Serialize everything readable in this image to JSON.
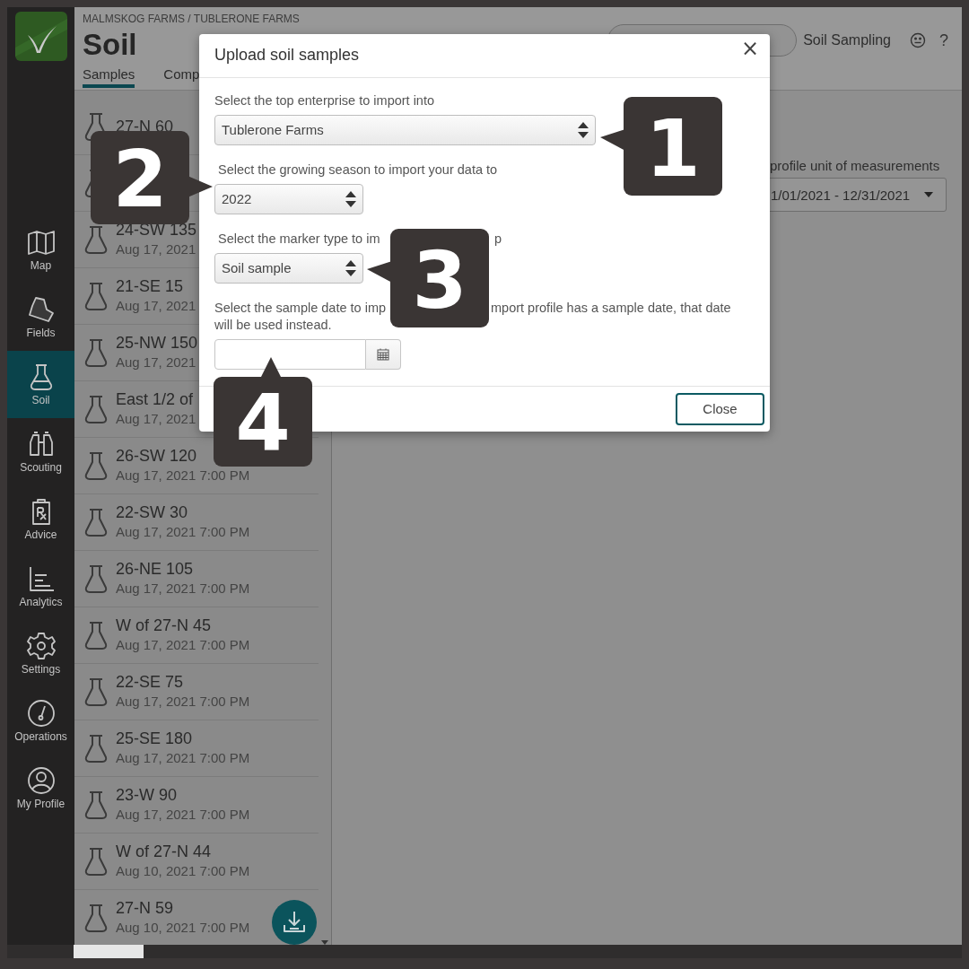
{
  "breadcrumb": "MALMSKOG FARMS / TUBLERONE FARMS",
  "page_title": "Soil",
  "tabs": [
    {
      "label": "Samples",
      "selected": true
    },
    {
      "label": "Comp",
      "selected": false
    }
  ],
  "header_link": "Soil Sampling",
  "help": "?",
  "nav": [
    {
      "kind": "map",
      "label": "Map",
      "selected": false
    },
    {
      "kind": "fields",
      "label": "Fields",
      "selected": false
    },
    {
      "kind": "soil",
      "label": "Soil",
      "selected": true
    },
    {
      "kind": "scouting",
      "label": "Scouting",
      "selected": false
    },
    {
      "kind": "advice",
      "label": "Advice",
      "selected": false
    },
    {
      "kind": "analytics",
      "label": "Analytics",
      "selected": false
    },
    {
      "kind": "settings",
      "label": "Settings",
      "selected": false
    },
    {
      "kind": "operations",
      "label": "Operations",
      "selected": false
    },
    {
      "kind": "profile",
      "label": "My Profile",
      "selected": false
    }
  ],
  "samples": [
    {
      "kind": "sample",
      "title": "27-N 60"
    },
    {
      "kind": "covered"
    },
    {
      "kind": "sample",
      "title": "24-SW 135",
      "date": "Aug 17, 2021"
    },
    {
      "kind": "sample",
      "title": "21-SE 15",
      "date": "Aug 17, 2021"
    },
    {
      "kind": "sample",
      "title": "25-NW 150",
      "date": "Aug 17, 2021"
    },
    {
      "kind": "sample",
      "title": "East 1/2 of",
      "date": "Aug 17, 2021"
    },
    {
      "kind": "sample",
      "title": "26-SW 120",
      "date": "Aug 17, 2021 7:00 PM"
    },
    {
      "kind": "sample",
      "title": "22-SW 30",
      "date": "Aug 17, 2021 7:00 PM"
    },
    {
      "kind": "sample",
      "title": "26-NE 105",
      "date": "Aug 17, 2021 7:00 PM"
    },
    {
      "kind": "sample",
      "title": "W of 27-N 45",
      "date": "Aug 17, 2021 7:00 PM"
    },
    {
      "kind": "sample",
      "title": "22-SE 75",
      "date": "Aug 17, 2021 7:00 PM"
    },
    {
      "kind": "sample",
      "title": "25-SE 180",
      "date": "Aug 17, 2021 7:00 PM"
    },
    {
      "kind": "sample",
      "title": "23-W 90",
      "date": "Aug 17, 2021 7:00 PM"
    },
    {
      "kind": "sample",
      "title": "W of 27-N 44",
      "date": "Aug 10, 2021 7:00 PM"
    },
    {
      "kind": "sample",
      "title": "27-N 59",
      "date": "Aug 10, 2021 7:00 PM"
    }
  ],
  "main": {
    "label": "profile unit of measurements",
    "date_range": "1/01/2021 - 12/31/2021"
  },
  "dialog": {
    "title": "Upload soil samples",
    "close": "×",
    "fields": [
      {
        "kind": "select",
        "label": "Select the top enterprise to import into",
        "value": "Tublerone Farms"
      },
      {
        "kind": "select",
        "label": "Select the growing season to import your data to",
        "value": "2022"
      },
      {
        "kind": "select",
        "label": "Select the marker type to im",
        "label_after": "p",
        "value": "Soil sample"
      },
      {
        "kind": "date",
        "label": "Select the sample date to imp",
        "label_after": "mport profile has a sample date, that date",
        "label_line2": "will be used instead."
      }
    ],
    "buttons": [
      "Close"
    ]
  },
  "callouts": [
    "1",
    "2",
    "3",
    "4"
  ]
}
